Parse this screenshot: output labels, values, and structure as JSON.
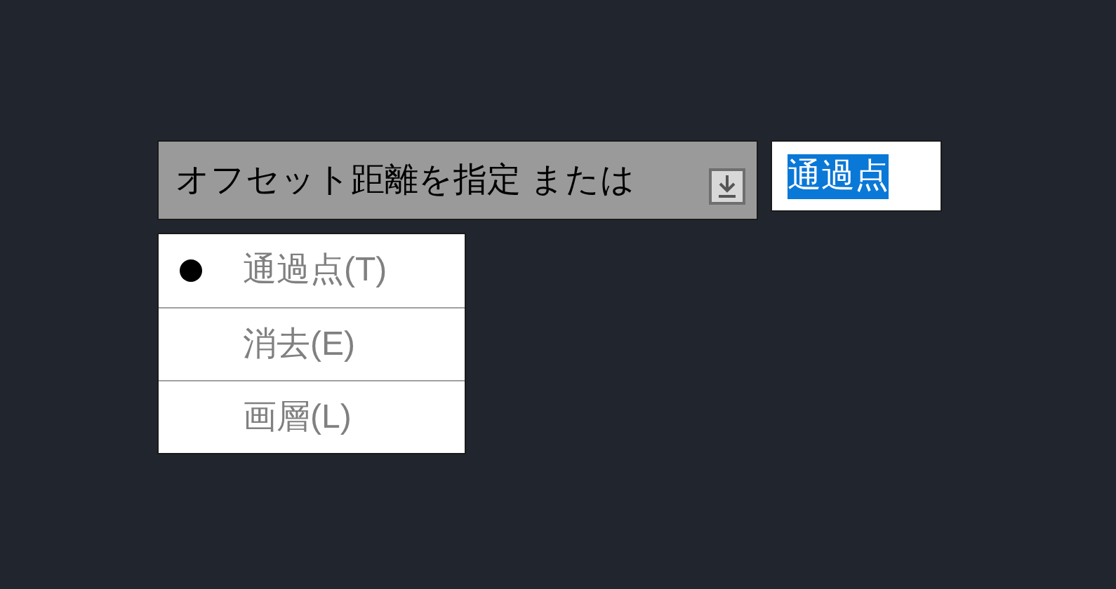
{
  "prompt": {
    "text": "オフセット距離を指定 または"
  },
  "input": {
    "value": "通過点",
    "highlighted": true
  },
  "options": [
    {
      "label": "通過点(T)",
      "selected": true
    },
    {
      "label": "消去(E)",
      "selected": false
    },
    {
      "label": "画層(L)",
      "selected": false
    }
  ]
}
